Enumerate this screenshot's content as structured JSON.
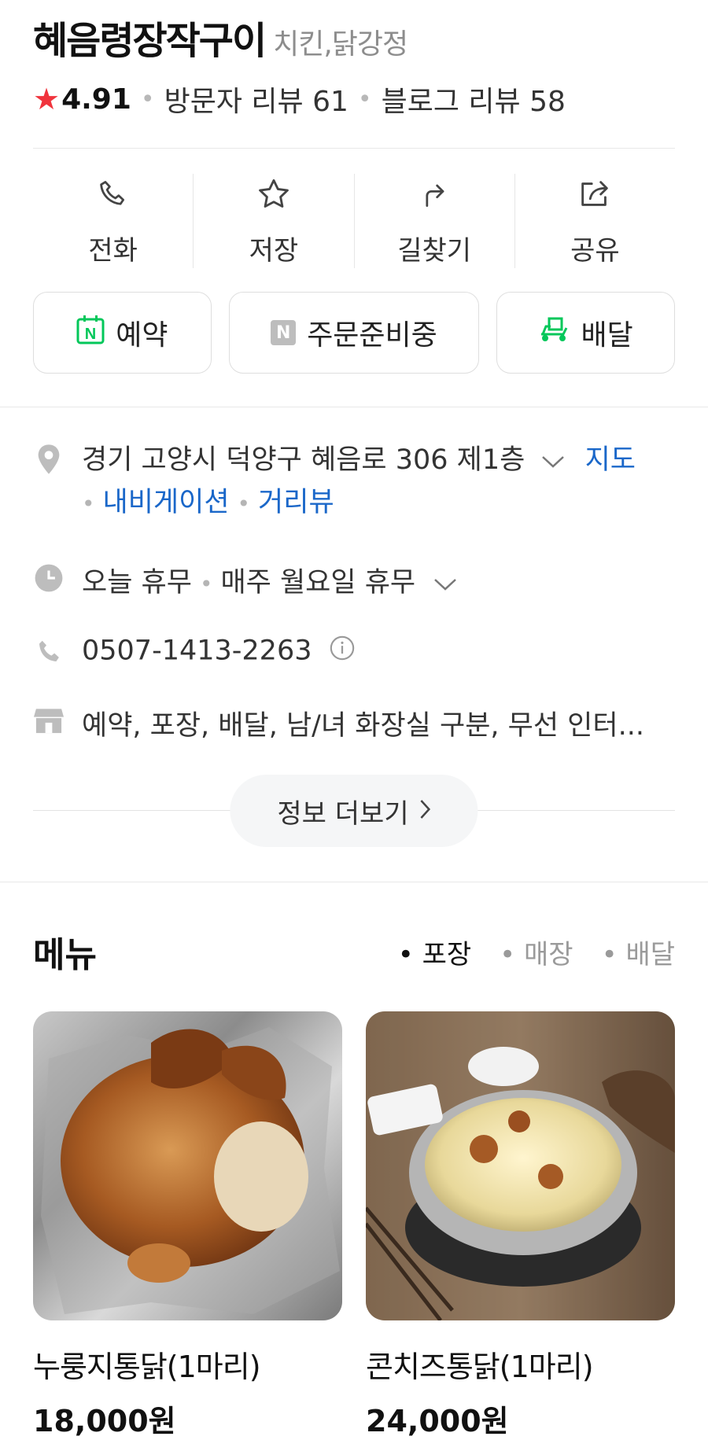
{
  "store": {
    "name": "혜음령장작구이",
    "category": "치킨,닭강정",
    "rating": "4.91",
    "visitor_reviews": "방문자 리뷰 61",
    "blog_reviews": "블로그 리뷰 58"
  },
  "actions": [
    {
      "label": "전화",
      "icon": "phone-icon"
    },
    {
      "label": "저장",
      "icon": "star-outline-icon"
    },
    {
      "label": "길찾기",
      "icon": "directions-icon"
    },
    {
      "label": "공유",
      "icon": "share-icon"
    }
  ],
  "chips": [
    {
      "label": "예약",
      "icon": "naver-calendar-icon",
      "color": "#03c75a"
    },
    {
      "label": "주문준비중",
      "icon": "naver-order-icon",
      "color": "#b5b5b5"
    },
    {
      "label": "배달",
      "icon": "delivery-scooter-icon",
      "color": "#03c75a"
    }
  ],
  "info": {
    "address": "경기 고양시 덕양구 혜음로 306 제1층",
    "map_link": "지도",
    "navigation_link": "내비게이션",
    "streetview_link": "거리뷰",
    "hours_status": "오늘 휴무",
    "hours_detail": "매주 월요일 휴무",
    "phone": "0507-1413-2263",
    "amenities": "예약, 포장, 배달, 남/녀 화장실 구분, 무선 인터..."
  },
  "more_info_label": "정보 더보기",
  "menu": {
    "title": "메뉴",
    "tabs": [
      {
        "label": "포장",
        "active": true
      },
      {
        "label": "매장",
        "active": false
      },
      {
        "label": "배달",
        "active": false
      }
    ],
    "items": [
      {
        "name": "누룽지통닭(1마리)",
        "price": "18,000원"
      },
      {
        "name": "콘치즈통닭(1마리)",
        "price": "24,000원"
      }
    ]
  },
  "colors": {
    "accent_link": "#1a67c9",
    "star": "#f0343d",
    "naver_green": "#03c75a"
  }
}
